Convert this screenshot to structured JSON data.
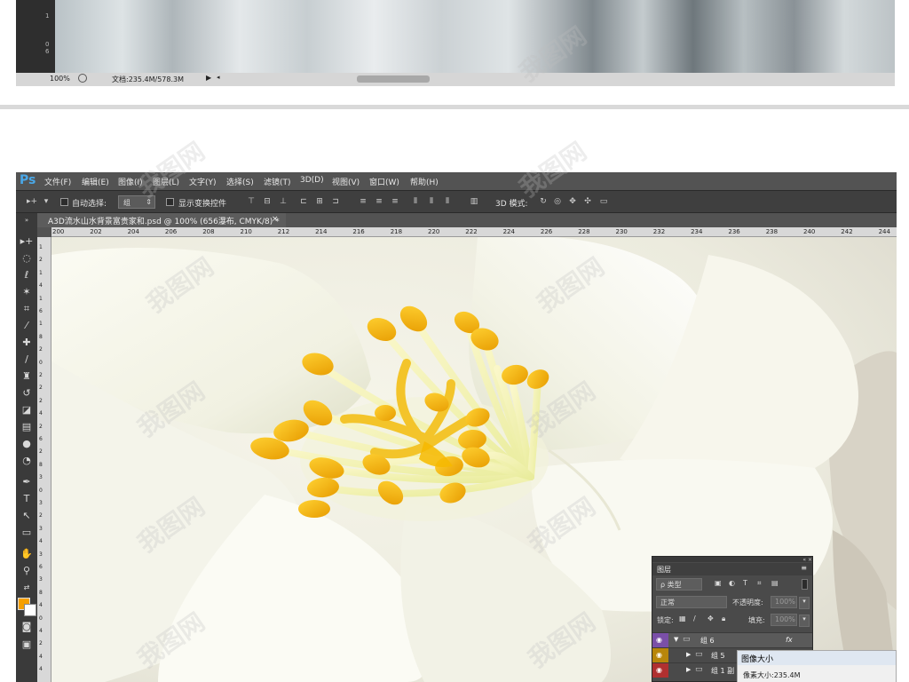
{
  "top_screenshot": {
    "ruler_numbers": [
      "1",
      "0",
      "6"
    ],
    "zoom": "100%",
    "doc_info": "文档:235.4M/578.3M"
  },
  "app": {
    "logo": "Ps",
    "menu": [
      "文件(F)",
      "编辑(E)",
      "图像(I)",
      "图层(L)",
      "文字(Y)",
      "选择(S)",
      "滤镜(T)",
      "3D(D)",
      "视图(V)",
      "窗口(W)",
      "帮助(H)"
    ]
  },
  "options": {
    "auto_select_label": "自动选择:",
    "auto_select_value": "组",
    "show_transform_label": "显示变换控件",
    "mode_3d_label": "3D 模式:"
  },
  "document": {
    "tab_title": "A3D流水山水背景富贵家和.psd @ 100% (656瀑布, CMYK/8) *",
    "tab_close": "×"
  },
  "rulers": {
    "h_ticks": [
      "200",
      "202",
      "204",
      "206",
      "208",
      "210",
      "212",
      "214",
      "216",
      "218",
      "220",
      "222",
      "224",
      "226",
      "228",
      "230",
      "232",
      "234",
      "236",
      "238",
      "240",
      "242",
      "244"
    ],
    "v_ticks": [
      "1",
      "2",
      "1",
      "4",
      "1",
      "6",
      "1",
      "8",
      "2",
      "0",
      "2",
      "2",
      "2",
      "4",
      "2",
      "6",
      "2",
      "8",
      "3",
      "0",
      "3",
      "2",
      "3",
      "4",
      "3",
      "6",
      "3",
      "8",
      "4",
      "0",
      "4",
      "2",
      "4",
      "4"
    ]
  },
  "layers_panel": {
    "panel_controls": "« ×",
    "tab": "图层",
    "filter_kind": "ρ 类型",
    "blend_mode": "正常",
    "opacity_label": "不透明度:",
    "opacity_value": "100%",
    "lock_label": "锁定:",
    "fill_label": "填充:",
    "fill_value": "100%",
    "layers": [
      {
        "name": "组 6",
        "eye_color": "#7a4fa8",
        "fx": "fx"
      },
      {
        "name": "组 5",
        "eye_color": "#b8860b",
        "fx": ""
      },
      {
        "name": "组 1 副",
        "eye_color": "#b03030",
        "fx": ""
      }
    ]
  },
  "image_size_dialog": {
    "title": "图像大小",
    "pixel_size": "像素大小:235.4M"
  },
  "watermark": "我图网"
}
